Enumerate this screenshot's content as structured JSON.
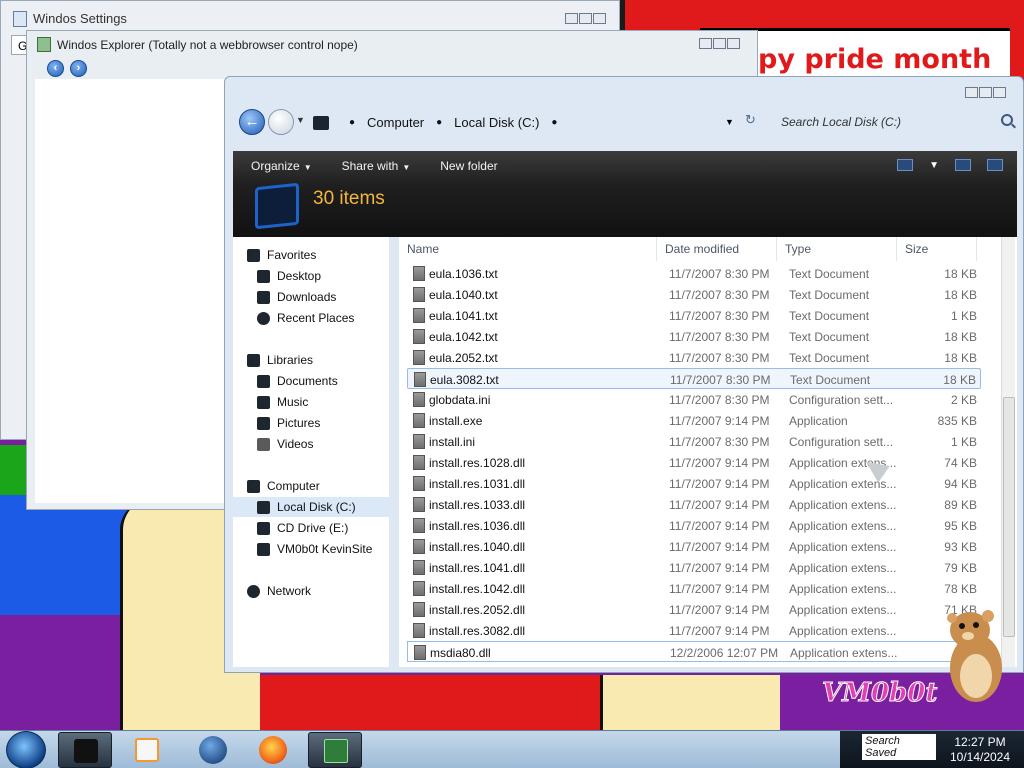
{
  "desktop": {
    "banner_text": "py pride month",
    "watermark_text": "VM0b0t"
  },
  "settings_window": {
    "title": "Windos Settings",
    "tab_stub": "G"
  },
  "bg_explorer": {
    "title": "Windos Explorer (Totally not a webbrowser control nope)"
  },
  "explorer": {
    "breadcrumb": [
      "Computer",
      "Local Disk (C:)"
    ],
    "search_placeholder": "Search Local Disk (C:)",
    "toolbar": {
      "organize": "Organize",
      "share_with": "Share with",
      "new_folder": "New folder"
    },
    "items_count": "30 items",
    "nav": {
      "favorites": "Favorites",
      "desktop": "Desktop",
      "downloads": "Downloads",
      "recent": "Recent Places",
      "libraries": "Libraries",
      "documents": "Documents",
      "music": "Music",
      "pictures": "Pictures",
      "videos": "Videos",
      "computer": "Computer",
      "local_disk": "Local Disk (C:)",
      "cd_drive": "CD Drive (E:)",
      "vm_site": "VM0b0t KevinSite",
      "network": "Network"
    },
    "columns": {
      "name": "Name",
      "date": "Date modified",
      "type": "Type",
      "size": "Size"
    },
    "files": [
      {
        "name": "eula.1036.txt",
        "date": "11/7/2007 8:30 PM",
        "type": "Text Document",
        "size": "18 KB"
      },
      {
        "name": "eula.1040.txt",
        "date": "11/7/2007 8:30 PM",
        "type": "Text Document",
        "size": "18 KB"
      },
      {
        "name": "eula.1041.txt",
        "date": "11/7/2007 8:30 PM",
        "type": "Text Document",
        "size": "1 KB"
      },
      {
        "name": "eula.1042.txt",
        "date": "11/7/2007 8:30 PM",
        "type": "Text Document",
        "size": "18 KB"
      },
      {
        "name": "eula.2052.txt",
        "date": "11/7/2007 8:30 PM",
        "type": "Text Document",
        "size": "18 KB"
      },
      {
        "name": "eula.3082.txt",
        "date": "11/7/2007 8:30 PM",
        "type": "Text Document",
        "size": "18 KB"
      },
      {
        "name": "globdata.ini",
        "date": "11/7/2007 8:30 PM",
        "type": "Configuration sett...",
        "size": "2 KB"
      },
      {
        "name": "install.exe",
        "date": "11/7/2007 9:14 PM",
        "type": "Application",
        "size": "835 KB"
      },
      {
        "name": "install.ini",
        "date": "11/7/2007 8:30 PM",
        "type": "Configuration sett...",
        "size": "1 KB"
      },
      {
        "name": "install.res.1028.dll",
        "date": "11/7/2007 9:14 PM",
        "type": "Application extens...",
        "size": "74 KB"
      },
      {
        "name": "install.res.1031.dll",
        "date": "11/7/2007 9:14 PM",
        "type": "Application extens...",
        "size": "94 KB"
      },
      {
        "name": "install.res.1033.dll",
        "date": "11/7/2007 9:14 PM",
        "type": "Application extens...",
        "size": "89 KB"
      },
      {
        "name": "install.res.1036.dll",
        "date": "11/7/2007 9:14 PM",
        "type": "Application extens...",
        "size": "95 KB"
      },
      {
        "name": "install.res.1040.dll",
        "date": "11/7/2007 9:14 PM",
        "type": "Application extens...",
        "size": "93 KB"
      },
      {
        "name": "install.res.1041.dll",
        "date": "11/7/2007 9:14 PM",
        "type": "Application extens...",
        "size": "79 KB"
      },
      {
        "name": "install.res.1042.dll",
        "date": "11/7/2007 9:14 PM",
        "type": "Application extens...",
        "size": "78 KB"
      },
      {
        "name": "install.res.2052.dll",
        "date": "11/7/2007 9:14 PM",
        "type": "Application extens...",
        "size": "71 KB"
      },
      {
        "name": "install.res.3082.dll",
        "date": "11/7/2007 9:14 PM",
        "type": "Application extens...",
        "size": ""
      },
      {
        "name": "msdia80.dll",
        "date": "12/2/2006 12:07 PM",
        "type": "Application extens...",
        "size": ""
      }
    ],
    "hover_index": 5,
    "focus_index": 18
  },
  "taskbar": {
    "search_saved": "Search Saved",
    "time": "12:27 PM",
    "date": "10/14/2024"
  },
  "colors": {
    "items_count": "#f3b63e",
    "banner_red": "#e0191b",
    "wall_purple": "#7a1fa0"
  }
}
